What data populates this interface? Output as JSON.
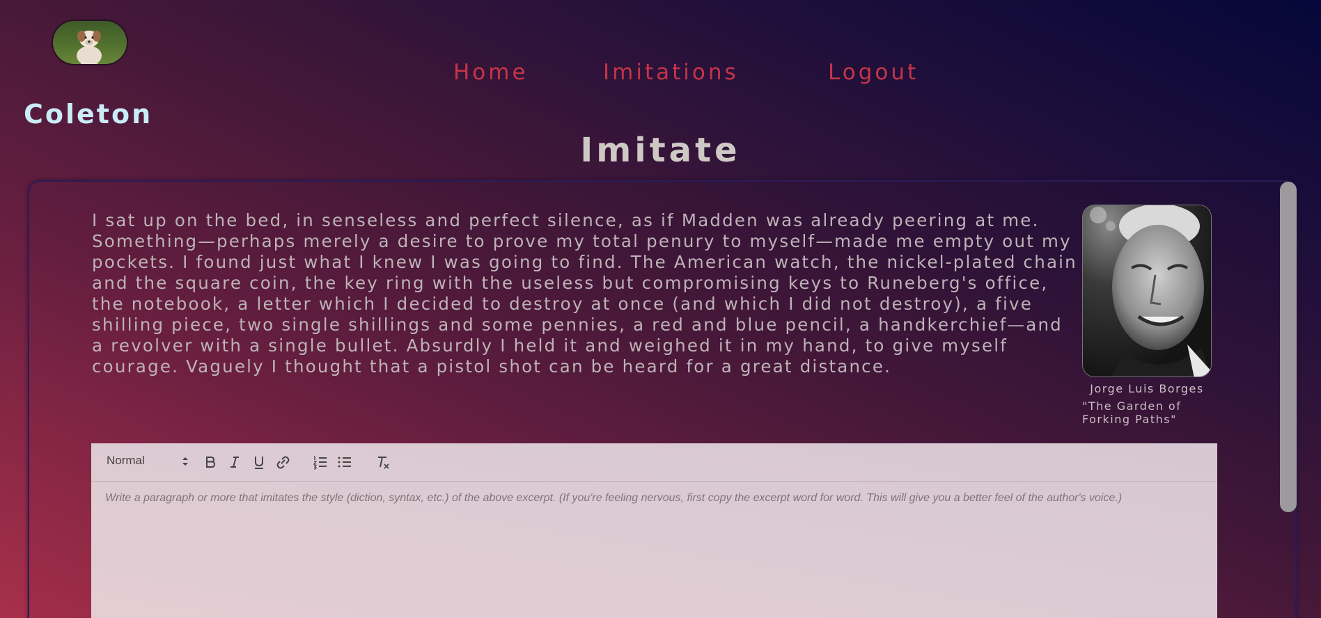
{
  "user": {
    "name": "Coleton"
  },
  "nav": {
    "items": [
      {
        "label": "Home"
      },
      {
        "label": "Imitations"
      },
      {
        "label": "Logout"
      }
    ]
  },
  "page": {
    "title": "Imitate"
  },
  "excerpt": {
    "text": "I sat up on the bed, in senseless and perfect silence, as if Madden was already peering at me. Something—perhaps merely a desire to prove my total penury to myself—made me empty out my pockets. I found just what I knew I was going to find. The American watch, the nickel-plated chain and the square coin, the key ring with the useless but compromising keys to Runeberg's office, the notebook, a letter which I decided to destroy at once (and which I did not destroy), a five shilling piece, two single shillings and some pennies, a red and blue pencil, a handkerchief—and a revolver with a single bullet. Absurdly I held it and weighed it in my hand, to give myself courage. Vaguely I thought that a pistol shot can be heard for a great distance.",
    "author": "Jorge Luis Borges",
    "work": "\"The Garden of Forking Paths\""
  },
  "editor": {
    "format_value": "Normal",
    "placeholder": "Write a paragraph or more that imitates the style (diction, syntax, etc.) of the above excerpt. (If you're feeling nervous, first copy the excerpt word for word. This will give you a better feel of the author's voice.)"
  },
  "colors": {
    "nav_link": "#c53548",
    "username": "#c9ecf7",
    "title": "#cfc9c6",
    "excerpt_text": "#bdb3b7"
  }
}
